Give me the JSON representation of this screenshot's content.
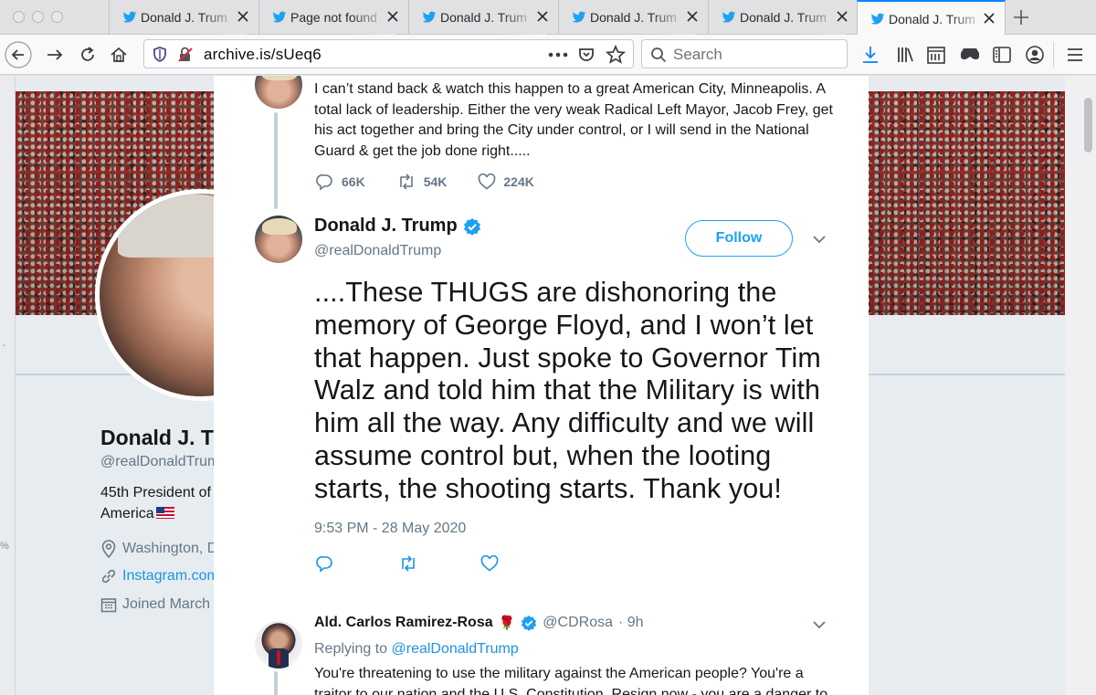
{
  "browser": {
    "tabs": [
      {
        "label": "Donald J. Trump",
        "active": false
      },
      {
        "label": "Page not found",
        "active": false
      },
      {
        "label": "Donald J. Trump",
        "active": false
      },
      {
        "label": "Donald J. Trump",
        "active": false
      },
      {
        "label": "Donald J. Trump",
        "active": false
      },
      {
        "label": "Donald J. Trump",
        "active": true
      }
    ],
    "url": "archive.is/sUeq6",
    "search_placeholder": "Search"
  },
  "profile": {
    "name": "Donald J. T",
    "handle": "@realDonaldTrum",
    "bio_line1": "45th President of",
    "bio_line2": "America",
    "location": "Washington, D",
    "website": "Instagram.com",
    "joined": "Joined March"
  },
  "thread": {
    "previous_tweet": {
      "text": "I can’t stand back & watch this happen to a great American City, Minneapolis. A total lack of leadership. Either the very weak Radical Left Mayor, Jacob Frey, get his act together and bring the City under control, or I will send in the National Guard & get the job done right.....",
      "replies": "66K",
      "retweets": "54K",
      "likes": "224K"
    },
    "main_tweet": {
      "name": "Donald J. Trump",
      "handle": "@realDonaldTrump",
      "follow_label": "Follow",
      "text": "....These THUGS are dishonoring the memory of George Floyd, and I won’t let that happen. Just spoke to Governor Tim Walz and told him that the Military is with him all the way. Any difficulty and we will assume control but, when the looting starts, the shooting starts. Thank you!",
      "timestamp": "9:53 PM - 28 May 2020"
    },
    "reply": {
      "name": "Ald. Carlos Ramirez-Rosa",
      "handle": "@CDRosa",
      "time": "· 9h",
      "replying_to_prefix": "Replying to",
      "replying_to": "@realDonaldTrump",
      "text": "You're threatening to use the military against the American people? You're a traitor to our nation and the U.S. Constitution. Resign now - you are a danger to"
    }
  },
  "side_marks": {
    "left_percent": "%",
    "left_dash": "-"
  },
  "colors": {
    "twitter_blue": "#1da1f2",
    "link_blue": "#1b95e0",
    "muted": "#657786",
    "firefox_blue": "#0a84ff"
  }
}
